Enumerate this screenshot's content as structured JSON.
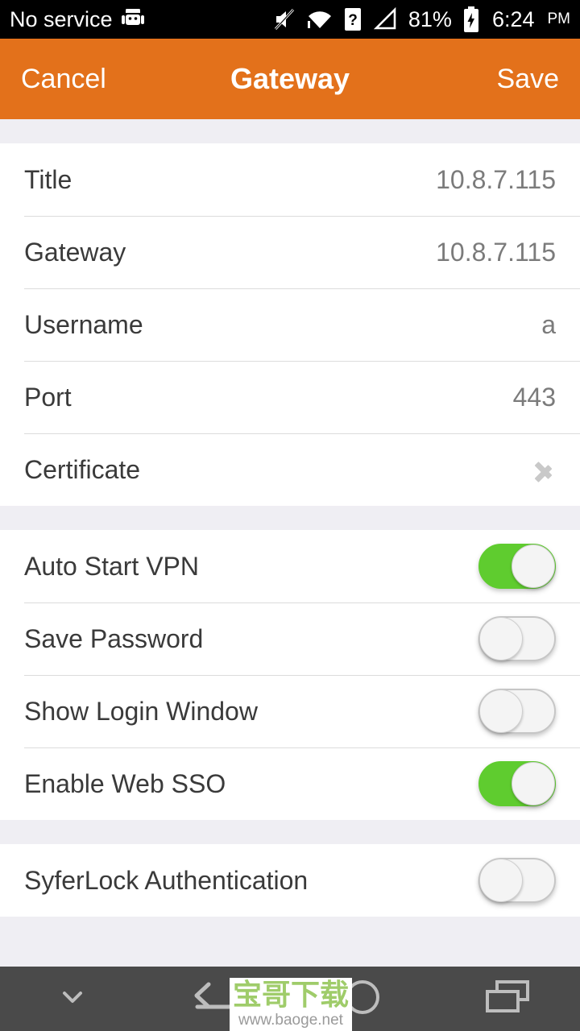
{
  "status_bar": {
    "carrier": "No service",
    "android_icon": "android-robot-icon",
    "icons": [
      "mute-icon",
      "wifi-icon",
      "sim-unknown-icon",
      "signal-icon"
    ],
    "battery_percent": "81%",
    "battery_icon": "battery-charging-icon",
    "time": "6:24",
    "am_pm": "PM"
  },
  "action_bar": {
    "cancel_label": "Cancel",
    "title": "Gateway",
    "save_label": "Save",
    "background_color": "#E3711B"
  },
  "sections": [
    {
      "name": "connection",
      "rows": [
        {
          "label": "Title",
          "value": "10.8.7.115",
          "type": "text"
        },
        {
          "label": "Gateway",
          "value": "10.8.7.115",
          "type": "text"
        },
        {
          "label": "Username",
          "value": "a",
          "type": "text"
        },
        {
          "label": "Port",
          "value": "443",
          "type": "text"
        },
        {
          "label": "Certificate",
          "value": "",
          "type": "disclosure"
        }
      ]
    },
    {
      "name": "options",
      "rows": [
        {
          "label": "Auto Start VPN",
          "type": "switch",
          "on": true
        },
        {
          "label": "Save Password",
          "type": "switch",
          "on": false
        },
        {
          "label": "Show Login Window",
          "type": "switch",
          "on": false
        },
        {
          "label": "Enable Web SSO",
          "type": "switch",
          "on": true
        }
      ]
    },
    {
      "name": "authentication",
      "rows": [
        {
          "label": "SyferLock Authentication",
          "type": "switch",
          "on": false
        }
      ]
    }
  ],
  "colors": {
    "accent_orange": "#E3711B",
    "switch_on_green": "#5FCC2F",
    "section_gap": "#EFEEF3",
    "label_text": "#3A3A3A",
    "value_text": "#7B7B7B",
    "nav_bar": "#4A4A4A"
  },
  "nav_bar": {
    "buttons": [
      "chevron-down-icon",
      "back-icon",
      "home-icon",
      "recents-icon"
    ]
  },
  "watermark": {
    "chinese": "宝哥下载",
    "url": "www.baoge.net",
    "text_color": "#9FCC6A"
  }
}
